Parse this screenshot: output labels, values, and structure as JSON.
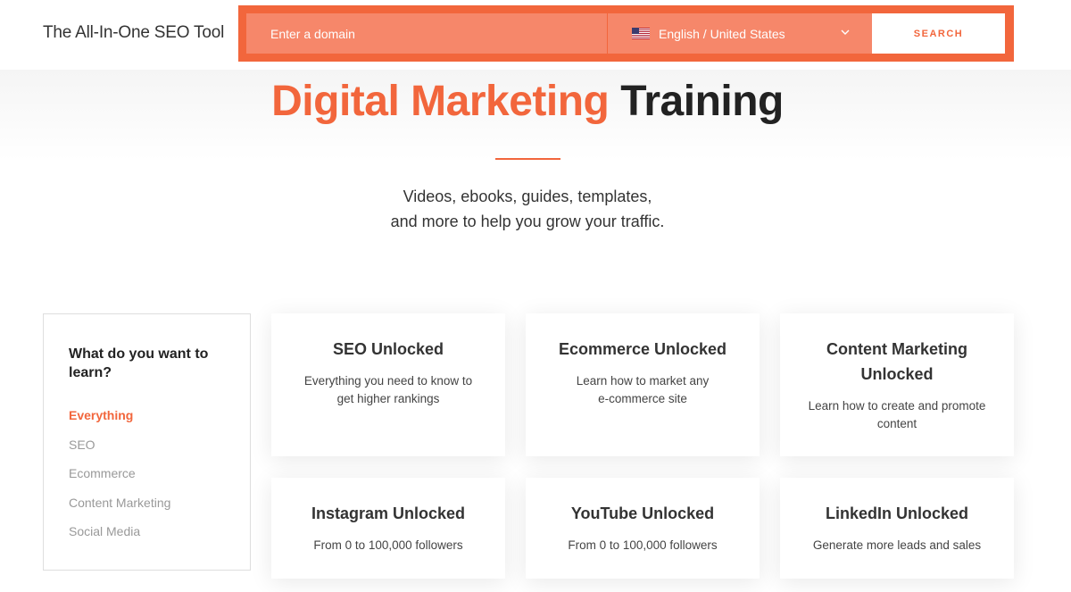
{
  "header": {
    "brand": "The All-In-One SEO Tool",
    "search": {
      "placeholder": "Enter a domain",
      "language": "English / United States",
      "button_label": "SEARCH"
    }
  },
  "hero": {
    "title_accent": "Digital Marketing",
    "title_rest": "Training",
    "subtitle_line1": "Videos, ebooks, guides, templates,",
    "subtitle_line2": "and more to help you grow your traffic."
  },
  "filters": {
    "title": "What do you want to learn?",
    "items": [
      {
        "label": "Everything",
        "active": true
      },
      {
        "label": "SEO",
        "active": false
      },
      {
        "label": "Ecommerce",
        "active": false
      },
      {
        "label": "Content Marketing",
        "active": false
      },
      {
        "label": "Social Media",
        "active": false
      }
    ]
  },
  "cards": [
    {
      "title": "SEO Unlocked",
      "desc": "Everything you need to know to get higher rankings"
    },
    {
      "title": "Ecommerce Unlocked",
      "desc": "Learn how to market any e-commerce site"
    },
    {
      "title": "Content Marketing Unlocked",
      "desc": "Learn how to create and promote content"
    },
    {
      "title": "Instagram Unlocked",
      "desc": "From 0 to 100,000 followers"
    },
    {
      "title": "YouTube Unlocked",
      "desc": "From 0 to 100,000 followers"
    },
    {
      "title": "LinkedIn Unlocked",
      "desc": "Generate more leads and sales"
    }
  ],
  "colors": {
    "accent": "#f2663c",
    "accent_light": "#f6876a"
  },
  "icons": {
    "flag": "us-flag-icon",
    "dropdown": "chevron-down-icon"
  }
}
